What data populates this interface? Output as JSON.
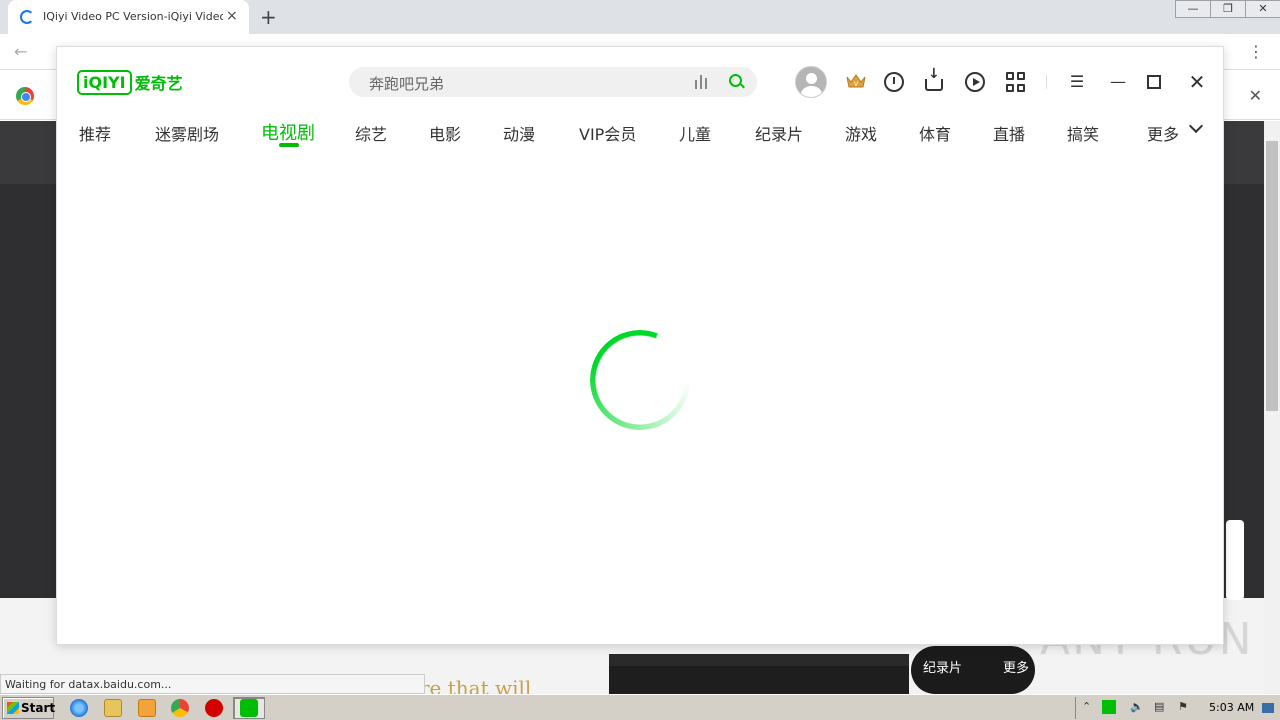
{
  "browser": {
    "tab_title": "IQiyi Video PC Version-iQiyi Video Of",
    "tab_close": "×",
    "new_tab": "+",
    "win_controls": [
      "—",
      "❐",
      "✕"
    ],
    "status": "Waiting for datax.baidu.com..."
  },
  "popup": {
    "logo_text": "iQIYI",
    "logo_cn": "爱奇艺",
    "search": {
      "placeholder": "奔跑吧兄弟"
    },
    "nav": [
      {
        "label": "推荐"
      },
      {
        "label": "迷雾剧场"
      },
      {
        "label": "电视剧",
        "active": true
      },
      {
        "label": "综艺"
      },
      {
        "label": "电影"
      },
      {
        "label": "动漫"
      },
      {
        "label": "VIP会员"
      },
      {
        "label": "儿童"
      },
      {
        "label": "纪录片"
      },
      {
        "label": "游戏"
      },
      {
        "label": "体育"
      },
      {
        "label": "直播"
      },
      {
        "label": "搞笑"
      },
      {
        "label": "更多"
      }
    ],
    "icons": [
      "avatar",
      "vip-crown-icon",
      "history-icon",
      "download-icon",
      "play-icon",
      "apps-grid-icon",
      "menu-icon",
      "minimize-icon",
      "maximize-icon",
      "close-icon"
    ],
    "accent": "#00be06"
  },
  "page_behind": {
    "headline_fragment": "re that will",
    "pill_left": "纪录片",
    "pill_right": "更多",
    "watermark": "ANY RUN"
  },
  "taskbar": {
    "start_label": "Start",
    "clock": "5:03 AM"
  }
}
